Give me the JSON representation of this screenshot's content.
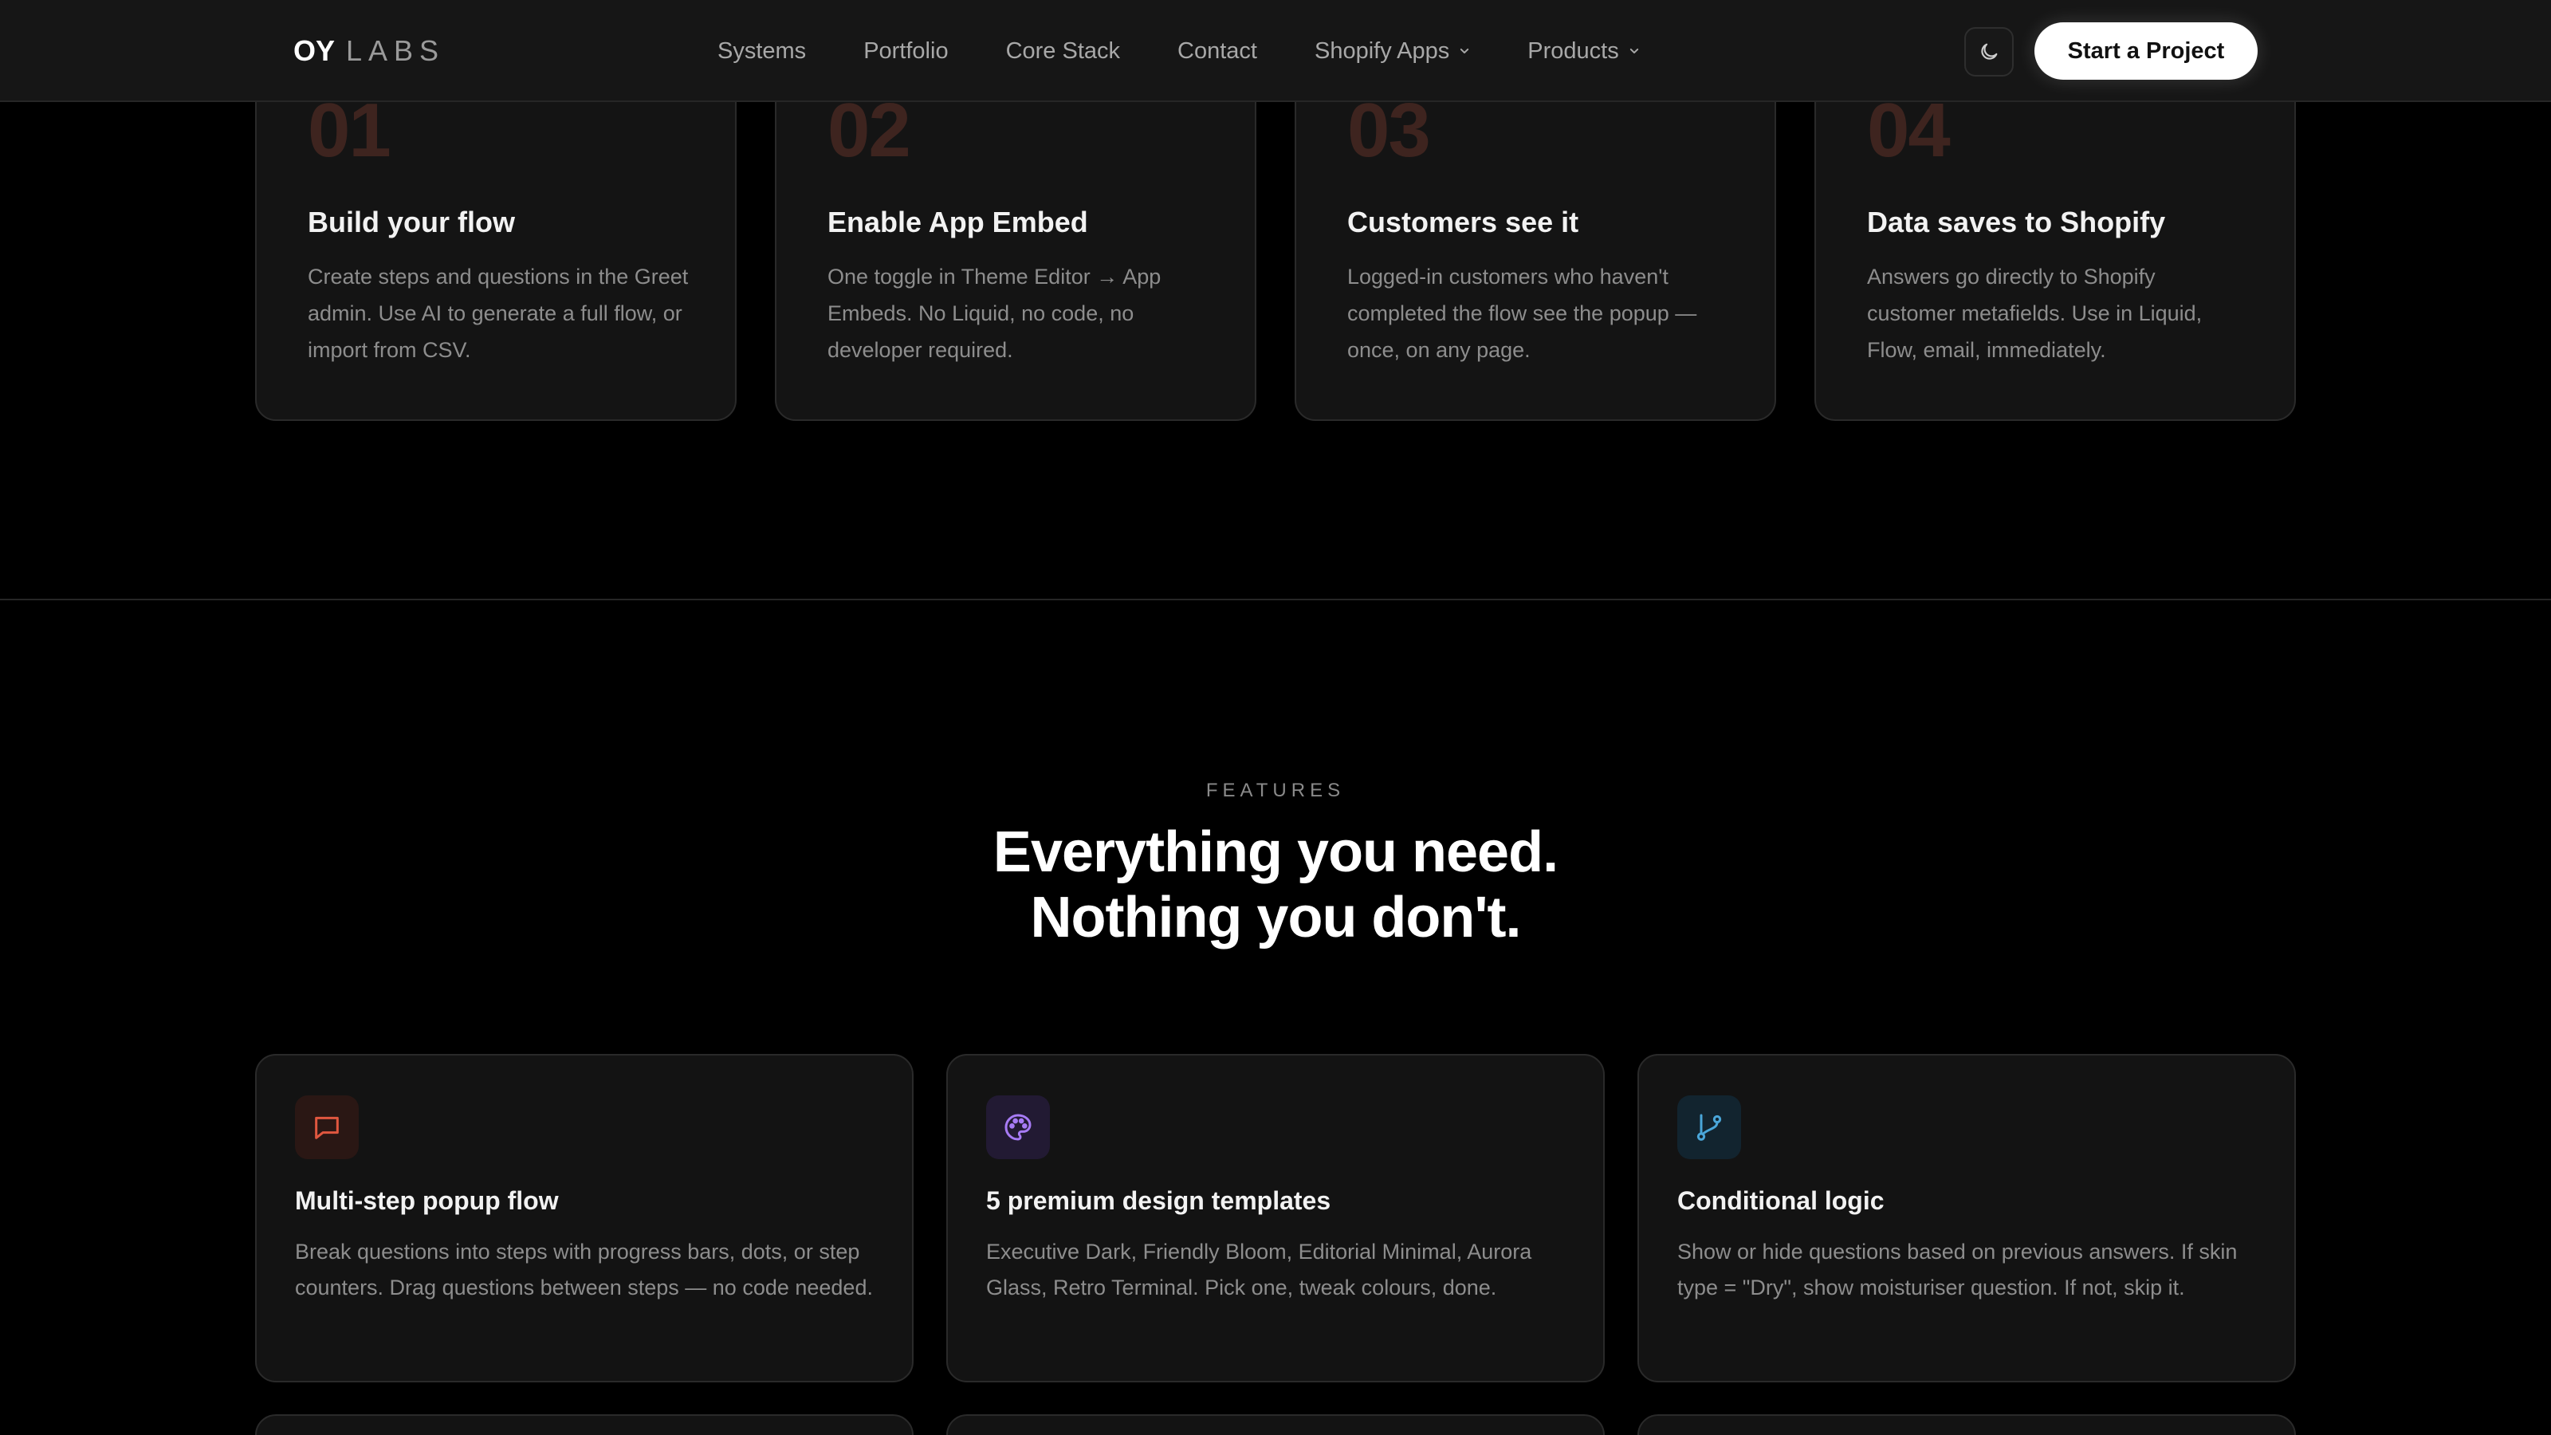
{
  "nav": {
    "logo_bold": "OY",
    "logo_light": "LABS",
    "links": [
      "Systems",
      "Portfolio",
      "Core Stack",
      "Contact",
      "Shopify Apps",
      "Products"
    ],
    "cta": "Start a Project"
  },
  "steps": [
    {
      "num": "01",
      "title": "Build your flow",
      "desc": "Create steps and questions in the Greet admin. Use AI to generate a full flow, or import from CSV."
    },
    {
      "num": "02",
      "title": "Enable App Embed",
      "desc": "One toggle in Theme Editor → App Embeds. No Liquid, no code, no developer required."
    },
    {
      "num": "03",
      "title": "Customers see it",
      "desc": "Logged-in customers who haven't completed the flow see the popup — once, on any page."
    },
    {
      "num": "04",
      "title": "Data saves to Shopify",
      "desc": "Answers go directly to Shopify customer metafields. Use in Liquid, Flow, email, immediately."
    }
  ],
  "features": {
    "eyebrow": "FEATURES",
    "headline_line1": "Everything you need.",
    "headline_line2": "Nothing you don't.",
    "cards": [
      {
        "icon": "chat-bubble-icon",
        "title": "Multi-step popup flow",
        "desc": "Break questions into steps with progress bars, dots, or step counters. Drag questions between steps — no code needed."
      },
      {
        "icon": "palette-icon",
        "title": "5 premium design templates",
        "desc": "Executive Dark, Friendly Bloom, Editorial Minimal, Aurora Glass, Retro Terminal. Pick one, tweak colours, done."
      },
      {
        "icon": "git-branch-icon",
        "title": "Conditional logic",
        "desc": "Show or hide questions based on previous answers. If skin type = \"Dry\", show moisturiser question. If not, skip it."
      }
    ]
  },
  "colors": {
    "accent_red": "#e0573f",
    "accent_purple": "#a77bf5",
    "accent_blue": "#4aa6d9"
  }
}
